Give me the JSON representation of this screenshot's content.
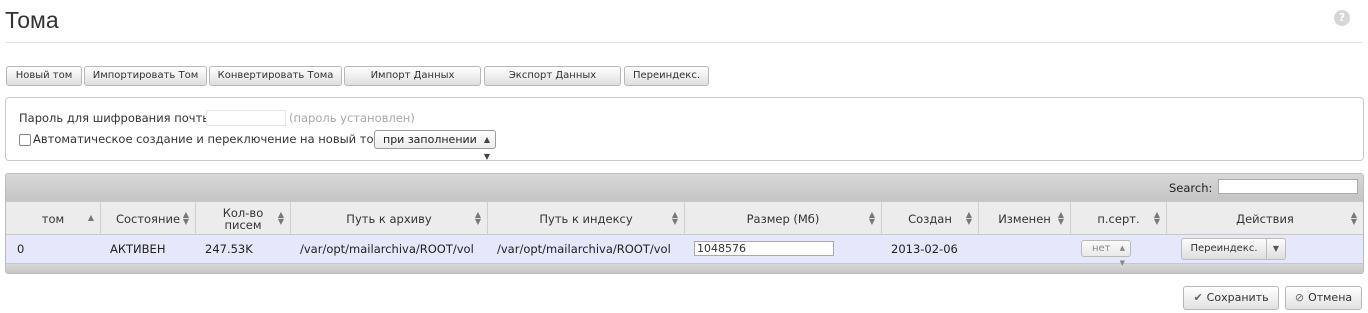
{
  "page": {
    "title": "Тома",
    "help_icon": "?"
  },
  "toolbar": {
    "new_volume": "Новый том",
    "import_volume": "Импортировать Том",
    "convert_volumes": "Конвертировать Тома",
    "import_data": "Импорт Данных",
    "export_data": "Экспорт Данных",
    "reindex": "Переиндекс."
  },
  "settings": {
    "password_label": "Пароль для шифрования почты",
    "password_value": "",
    "password_note": "(пароль установлен)",
    "auto_create_checked": false,
    "auto_create_label": "Автоматическое создание и переключение на новый том",
    "auto_create_option": "при заполнении"
  },
  "table": {
    "search_label": "Search:",
    "search_value": "",
    "columns": [
      "том",
      "Состояние",
      "Кол-во писем",
      "Путь к архиву",
      "Путь к индексу",
      "Размер (Мб)",
      "Создан",
      "Изменен",
      "п.серт.",
      "Действия"
    ],
    "rows": [
      {
        "volume": "0",
        "state": "АКТИВЕН",
        "message_count": "247.53K",
        "archive_path": "/var/opt/mailarchiva/ROOT/vol",
        "index_path": "/var/opt/mailarchiva/ROOT/vol",
        "size_mb": "1048576",
        "created": "2013-02-06",
        "modified": "",
        "cert": "нет",
        "action": "Переиндекс."
      }
    ]
  },
  "footer": {
    "save": "Сохранить",
    "cancel": "Отмена"
  },
  "icons": {
    "save": "check-icon",
    "cancel": "cancel-circle-icon",
    "sort": "sort-arrows-icon"
  },
  "colors": {
    "row_highlight": "#e6e7fb",
    "table_header": "#ececec"
  }
}
